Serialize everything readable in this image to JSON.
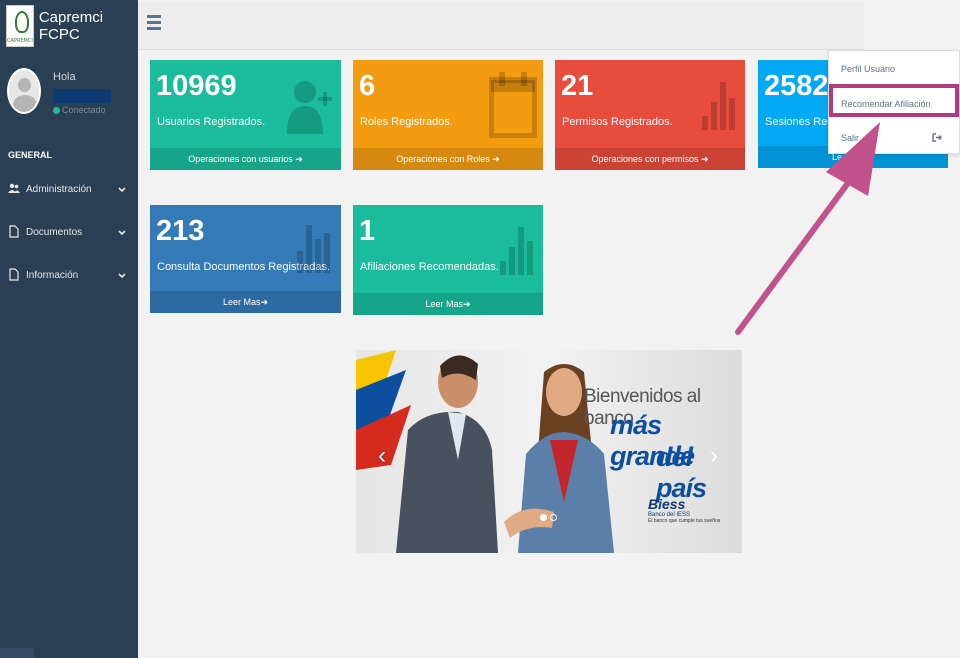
{
  "brand": {
    "title": "Capremci FCPC",
    "logo_text": "CAPREMCI"
  },
  "profile": {
    "greeting": "Hola",
    "status": "Conectado"
  },
  "sidebar": {
    "section": "GENERAL",
    "items": [
      {
        "label": "Administración",
        "icon": "users-icon"
      },
      {
        "label": "Documentos",
        "icon": "file-icon"
      },
      {
        "label": "Información",
        "icon": "file-icon"
      }
    ]
  },
  "tiles": [
    {
      "value": "10969",
      "label": "Usuarios Registrados.",
      "footer": "Operaciones con usuarios",
      "color": "#1abc9c",
      "icon": "add-user-icon"
    },
    {
      "value": "6",
      "label": "Roles Registrados.",
      "footer": "Operaciones con Roles",
      "color": "#f39c12",
      "icon": "calendar-icon"
    },
    {
      "value": "21",
      "label": "Permisos Registrados.",
      "footer": "Operaciones con permisos",
      "color": "#e74c3c",
      "icon": "bar-chart-icon"
    },
    {
      "value": "2582",
      "label": "Sesiones Regist",
      "footer": "Le",
      "color": "#03a9f4",
      "icon": "bar-chart-icon"
    },
    {
      "value": "213",
      "label": "Consulta Documentos Registradas.",
      "footer": "Leer Mas",
      "color": "#337ab7",
      "icon": "bar-chart-icon"
    },
    {
      "value": "1",
      "label": "Afiliaciones Recomendadas.",
      "footer": "Leer Mas",
      "color": "#1abc9c",
      "icon": "bar-chart-icon"
    }
  ],
  "dropdown": {
    "items": [
      {
        "label": "Perfil Usuario"
      },
      {
        "label": "Recomendar Afiliación"
      },
      {
        "label": "Salir",
        "icon": "sign-out-icon"
      }
    ],
    "highlight_color": "#b33a7d"
  },
  "banner": {
    "line1": "Bienvenidos al banco",
    "line2": "más grande",
    "line3": "del país",
    "logo_name": "Biess",
    "logo_sub": "Banco del IESS",
    "logo_tagline": "El banco que cumple tus sueños"
  },
  "annotation": {
    "arrow_color": "#c2528b"
  }
}
